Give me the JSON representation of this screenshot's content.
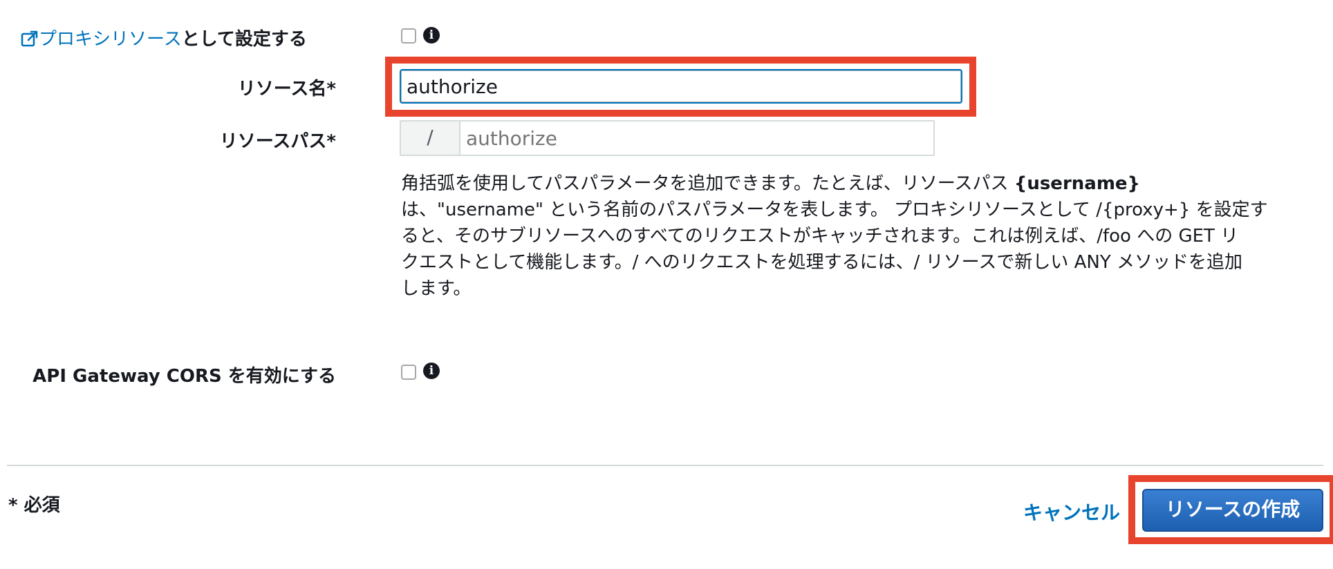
{
  "form": {
    "proxy_resource": {
      "icon": "external-link-icon",
      "link_label": "プロキシリソース",
      "label_suffix": "として設定する",
      "checked": false,
      "info_icon": "info-icon"
    },
    "resource_name": {
      "label": "リソース名*",
      "value": "authorize"
    },
    "resource_path": {
      "label": "リソースパス*",
      "prefix": "/",
      "placeholder": "authorize"
    },
    "help": {
      "line1_text": "角括弧を使用してパスパラメータを追加できます。たとえば、リソースパス ",
      "line1_bold": "{username}",
      "lines": [
        "は、\"username\" という名前のパスパラメータを表します。 プロキシリソースとして /{proxy+} を設定す",
        "ると、そのサブリソースへのすべてのリクエストがキャッチされます。これは例えば、/foo への GET リ",
        "クエストとして機能します。/ へのリクエストを処理するには、/ リソースで新しい ANY メソッドを追加",
        "します。"
      ]
    },
    "cors": {
      "label": "API Gateway CORS を有効にする",
      "checked": false,
      "info_icon": "info-icon"
    }
  },
  "footer": {
    "required_note": "* 必須",
    "cancel_label": "キャンセル",
    "create_label": "リソースの作成"
  },
  "colors": {
    "link": "#0073bb",
    "highlight": "#e8432d",
    "primary": "#1d5fb1"
  }
}
